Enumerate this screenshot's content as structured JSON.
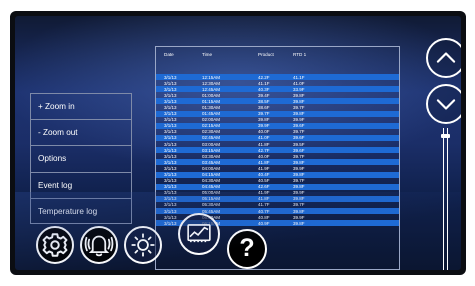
{
  "table": {
    "columns": [
      "Date",
      "Time",
      "Product",
      "RTD 1"
    ],
    "rows": [
      [
        "3/1/13",
        "12:15AM",
        "42.2F",
        "41.1F"
      ],
      [
        "3/1/13",
        "12:30AM",
        "41.1F",
        "41.0F"
      ],
      [
        "3/1/13",
        "12:45AM",
        "40.3F",
        "33.9F"
      ],
      [
        "3/1/13",
        "01:00AM",
        "39.4F",
        "39.8F"
      ],
      [
        "3/1/13",
        "01:15AM",
        "38.5F",
        "39.8F"
      ],
      [
        "3/1/13",
        "01:30AM",
        "38.6F",
        "39.7F"
      ],
      [
        "3/1/13",
        "01:45AM",
        "39.7F",
        "39.8F"
      ],
      [
        "3/1/13",
        "02:00AM",
        "39.8F",
        "39.9F"
      ],
      [
        "3/1/13",
        "02:15AM",
        "39.9F",
        "39.6F"
      ],
      [
        "3/1/13",
        "02:30AM",
        "40.0F",
        "39.7F"
      ],
      [
        "3/1/13",
        "02:45AM",
        "41.0F",
        "39.6F"
      ],
      [
        "3/1/13",
        "03:00AM",
        "41.8F",
        "39.5F"
      ],
      [
        "3/1/13",
        "03:15AM",
        "42.7F",
        "39.6F"
      ],
      [
        "3/1/13",
        "03:30AM",
        "40.0F",
        "39.7F"
      ],
      [
        "3/1/13",
        "03:45AM",
        "41.8F",
        "39.8F"
      ],
      [
        "3/1/13",
        "04:00AM",
        "41.9F",
        "39.9F"
      ],
      [
        "3/1/13",
        "04:15AM",
        "40.4F",
        "39.8F"
      ],
      [
        "3/1/13",
        "04:30AM",
        "40.5F",
        "39.7F"
      ],
      [
        "3/1/13",
        "04:45AM",
        "42.6F",
        "39.8F"
      ],
      [
        "3/1/13",
        "05:00AM",
        "41.9F",
        "39.9F"
      ],
      [
        "3/1/13",
        "05:15AM",
        "41.8F",
        "39.8F"
      ],
      [
        "3/1/13",
        "05:30AM",
        "41.7F",
        "39.7F"
      ],
      [
        "3/1/13",
        "05:45AM",
        "40.7F",
        "39.8F"
      ],
      [
        "3/1/13",
        "06:00AM",
        "40.8F",
        "39.9F"
      ],
      [
        "3/1/13",
        "06:15AM",
        "40.9F",
        "39.8F"
      ]
    ]
  },
  "menu": {
    "items": [
      "+ Zoom in",
      "-  Zoom out",
      "Options",
      "Event log",
      "Temperature log"
    ]
  },
  "toolbar": {
    "icons": [
      "gear-icon",
      "alarm-bell-icon",
      "brightness-icon",
      "temperature-log-icon",
      "help-icon"
    ],
    "help_label": "?"
  },
  "controls": {
    "icons": [
      "chevron-up-icon",
      "chevron-down-icon"
    ]
  },
  "colors": {
    "background": "#1b2e68",
    "row_highlight": "#1e6ad4",
    "text": "#ffffff",
    "border": "#9aa7c6"
  }
}
